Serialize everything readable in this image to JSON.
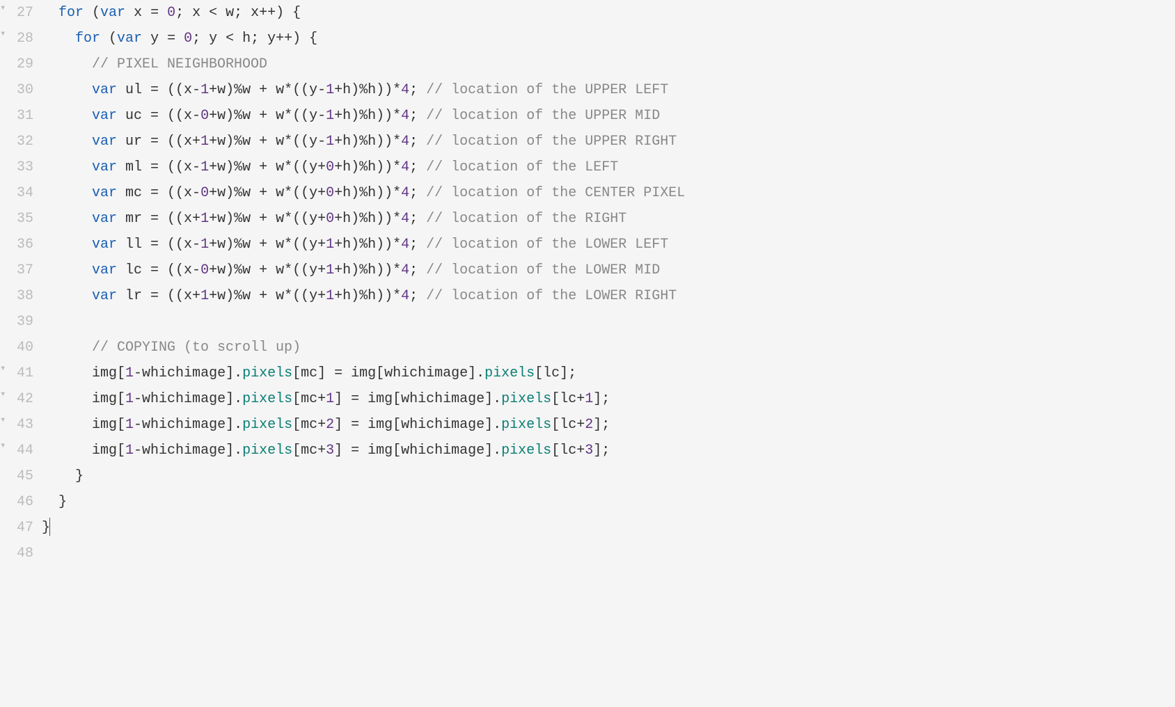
{
  "editor": {
    "startLine": 27,
    "cursorLine": 47,
    "lines": [
      {
        "num": 27,
        "foldable": true,
        "indent": "  ",
        "tokens": [
          {
            "t": "keyword",
            "v": "for"
          },
          {
            "t": "punct",
            "v": " ("
          },
          {
            "t": "keyword",
            "v": "var"
          },
          {
            "t": "ident",
            "v": " x "
          },
          {
            "t": "punct",
            "v": "= "
          },
          {
            "t": "number",
            "v": "0"
          },
          {
            "t": "punct",
            "v": "; x < w; x++) {"
          }
        ]
      },
      {
        "num": 28,
        "foldable": true,
        "indent": "    ",
        "tokens": [
          {
            "t": "keyword",
            "v": "for"
          },
          {
            "t": "punct",
            "v": " ("
          },
          {
            "t": "keyword",
            "v": "var"
          },
          {
            "t": "ident",
            "v": " y "
          },
          {
            "t": "punct",
            "v": "= "
          },
          {
            "t": "number",
            "v": "0"
          },
          {
            "t": "punct",
            "v": "; y < h; y++) {"
          }
        ]
      },
      {
        "num": 29,
        "foldable": false,
        "indent": "      ",
        "tokens": [
          {
            "t": "comment",
            "v": "// PIXEL NEIGHBORHOOD"
          }
        ]
      },
      {
        "num": 30,
        "foldable": false,
        "indent": "      ",
        "tokens": [
          {
            "t": "keyword",
            "v": "var"
          },
          {
            "t": "ident",
            "v": " ul = ((x-"
          },
          {
            "t": "number",
            "v": "1"
          },
          {
            "t": "ident",
            "v": "+w)%w + w*((y-"
          },
          {
            "t": "number",
            "v": "1"
          },
          {
            "t": "ident",
            "v": "+h)%h))*"
          },
          {
            "t": "number",
            "v": "4"
          },
          {
            "t": "punct",
            "v": "; "
          },
          {
            "t": "comment",
            "v": "// location of the UPPER LEFT"
          }
        ]
      },
      {
        "num": 31,
        "foldable": false,
        "indent": "      ",
        "tokens": [
          {
            "t": "keyword",
            "v": "var"
          },
          {
            "t": "ident",
            "v": " uc = ((x-"
          },
          {
            "t": "number",
            "v": "0"
          },
          {
            "t": "ident",
            "v": "+w)%w + w*((y-"
          },
          {
            "t": "number",
            "v": "1"
          },
          {
            "t": "ident",
            "v": "+h)%h))*"
          },
          {
            "t": "number",
            "v": "4"
          },
          {
            "t": "punct",
            "v": "; "
          },
          {
            "t": "comment",
            "v": "// location of the UPPER MID"
          }
        ]
      },
      {
        "num": 32,
        "foldable": false,
        "indent": "      ",
        "tokens": [
          {
            "t": "keyword",
            "v": "var"
          },
          {
            "t": "ident",
            "v": " ur = ((x+"
          },
          {
            "t": "number",
            "v": "1"
          },
          {
            "t": "ident",
            "v": "+w)%w + w*((y-"
          },
          {
            "t": "number",
            "v": "1"
          },
          {
            "t": "ident",
            "v": "+h)%h))*"
          },
          {
            "t": "number",
            "v": "4"
          },
          {
            "t": "punct",
            "v": "; "
          },
          {
            "t": "comment",
            "v": "// location of the UPPER RIGHT"
          }
        ]
      },
      {
        "num": 33,
        "foldable": false,
        "indent": "      ",
        "tokens": [
          {
            "t": "keyword",
            "v": "var"
          },
          {
            "t": "ident",
            "v": " ml = ((x-"
          },
          {
            "t": "number",
            "v": "1"
          },
          {
            "t": "ident",
            "v": "+w)%w + w*((y+"
          },
          {
            "t": "number",
            "v": "0"
          },
          {
            "t": "ident",
            "v": "+h)%h))*"
          },
          {
            "t": "number",
            "v": "4"
          },
          {
            "t": "punct",
            "v": "; "
          },
          {
            "t": "comment",
            "v": "// location of the LEFT"
          }
        ]
      },
      {
        "num": 34,
        "foldable": false,
        "indent": "      ",
        "tokens": [
          {
            "t": "keyword",
            "v": "var"
          },
          {
            "t": "ident",
            "v": " mc = ((x-"
          },
          {
            "t": "number",
            "v": "0"
          },
          {
            "t": "ident",
            "v": "+w)%w + w*((y+"
          },
          {
            "t": "number",
            "v": "0"
          },
          {
            "t": "ident",
            "v": "+h)%h))*"
          },
          {
            "t": "number",
            "v": "4"
          },
          {
            "t": "punct",
            "v": "; "
          },
          {
            "t": "comment",
            "v": "// location of the CENTER PIXEL"
          }
        ]
      },
      {
        "num": 35,
        "foldable": false,
        "indent": "      ",
        "tokens": [
          {
            "t": "keyword",
            "v": "var"
          },
          {
            "t": "ident",
            "v": " mr = ((x+"
          },
          {
            "t": "number",
            "v": "1"
          },
          {
            "t": "ident",
            "v": "+w)%w + w*((y+"
          },
          {
            "t": "number",
            "v": "0"
          },
          {
            "t": "ident",
            "v": "+h)%h))*"
          },
          {
            "t": "number",
            "v": "4"
          },
          {
            "t": "punct",
            "v": "; "
          },
          {
            "t": "comment",
            "v": "// location of the RIGHT"
          }
        ]
      },
      {
        "num": 36,
        "foldable": false,
        "indent": "      ",
        "tokens": [
          {
            "t": "keyword",
            "v": "var"
          },
          {
            "t": "ident",
            "v": " ll = ((x-"
          },
          {
            "t": "number",
            "v": "1"
          },
          {
            "t": "ident",
            "v": "+w)%w + w*((y+"
          },
          {
            "t": "number",
            "v": "1"
          },
          {
            "t": "ident",
            "v": "+h)%h))*"
          },
          {
            "t": "number",
            "v": "4"
          },
          {
            "t": "punct",
            "v": "; "
          },
          {
            "t": "comment",
            "v": "// location of the LOWER LEFT"
          }
        ]
      },
      {
        "num": 37,
        "foldable": false,
        "indent": "      ",
        "tokens": [
          {
            "t": "keyword",
            "v": "var"
          },
          {
            "t": "ident",
            "v": " lc = ((x-"
          },
          {
            "t": "number",
            "v": "0"
          },
          {
            "t": "ident",
            "v": "+w)%w + w*((y+"
          },
          {
            "t": "number",
            "v": "1"
          },
          {
            "t": "ident",
            "v": "+h)%h))*"
          },
          {
            "t": "number",
            "v": "4"
          },
          {
            "t": "punct",
            "v": "; "
          },
          {
            "t": "comment",
            "v": "// location of the LOWER MID"
          }
        ]
      },
      {
        "num": 38,
        "foldable": false,
        "indent": "      ",
        "tokens": [
          {
            "t": "keyword",
            "v": "var"
          },
          {
            "t": "ident",
            "v": " lr = ((x+"
          },
          {
            "t": "number",
            "v": "1"
          },
          {
            "t": "ident",
            "v": "+w)%w + w*((y+"
          },
          {
            "t": "number",
            "v": "1"
          },
          {
            "t": "ident",
            "v": "+h)%h))*"
          },
          {
            "t": "number",
            "v": "4"
          },
          {
            "t": "punct",
            "v": "; "
          },
          {
            "t": "comment",
            "v": "// location of the LOWER RIGHT"
          }
        ]
      },
      {
        "num": 39,
        "foldable": false,
        "indent": "",
        "tokens": []
      },
      {
        "num": 40,
        "foldable": false,
        "indent": "      ",
        "tokens": [
          {
            "t": "comment",
            "v": "// COPYING (to scroll up)"
          }
        ]
      },
      {
        "num": 41,
        "foldable": true,
        "indent": "      ",
        "tokens": [
          {
            "t": "ident",
            "v": "img["
          },
          {
            "t": "number",
            "v": "1"
          },
          {
            "t": "ident",
            "v": "-whichimage]."
          },
          {
            "t": "prop",
            "v": "pixels"
          },
          {
            "t": "ident",
            "v": "[mc] = img[whichimage]."
          },
          {
            "t": "prop",
            "v": "pixels"
          },
          {
            "t": "ident",
            "v": "[lc];"
          }
        ]
      },
      {
        "num": 42,
        "foldable": true,
        "indent": "      ",
        "tokens": [
          {
            "t": "ident",
            "v": "img["
          },
          {
            "t": "number",
            "v": "1"
          },
          {
            "t": "ident",
            "v": "-whichimage]."
          },
          {
            "t": "prop",
            "v": "pixels"
          },
          {
            "t": "ident",
            "v": "[mc+"
          },
          {
            "t": "number",
            "v": "1"
          },
          {
            "t": "ident",
            "v": "] = img[whichimage]."
          },
          {
            "t": "prop",
            "v": "pixels"
          },
          {
            "t": "ident",
            "v": "[lc+"
          },
          {
            "t": "number",
            "v": "1"
          },
          {
            "t": "ident",
            "v": "];"
          }
        ]
      },
      {
        "num": 43,
        "foldable": true,
        "indent": "      ",
        "tokens": [
          {
            "t": "ident",
            "v": "img["
          },
          {
            "t": "number",
            "v": "1"
          },
          {
            "t": "ident",
            "v": "-whichimage]."
          },
          {
            "t": "prop",
            "v": "pixels"
          },
          {
            "t": "ident",
            "v": "[mc+"
          },
          {
            "t": "number",
            "v": "2"
          },
          {
            "t": "ident",
            "v": "] = img[whichimage]."
          },
          {
            "t": "prop",
            "v": "pixels"
          },
          {
            "t": "ident",
            "v": "[lc+"
          },
          {
            "t": "number",
            "v": "2"
          },
          {
            "t": "ident",
            "v": "];"
          }
        ]
      },
      {
        "num": 44,
        "foldable": true,
        "indent": "      ",
        "tokens": [
          {
            "t": "ident",
            "v": "img["
          },
          {
            "t": "number",
            "v": "1"
          },
          {
            "t": "ident",
            "v": "-whichimage]."
          },
          {
            "t": "prop",
            "v": "pixels"
          },
          {
            "t": "ident",
            "v": "[mc+"
          },
          {
            "t": "number",
            "v": "3"
          },
          {
            "t": "ident",
            "v": "] = img[whichimage]."
          },
          {
            "t": "prop",
            "v": "pixels"
          },
          {
            "t": "ident",
            "v": "[lc+"
          },
          {
            "t": "number",
            "v": "3"
          },
          {
            "t": "ident",
            "v": "];"
          }
        ]
      },
      {
        "num": 45,
        "foldable": false,
        "indent": "    ",
        "tokens": [
          {
            "t": "punct",
            "v": "}"
          }
        ]
      },
      {
        "num": 46,
        "foldable": false,
        "indent": "  ",
        "tokens": [
          {
            "t": "punct",
            "v": "}"
          }
        ]
      },
      {
        "num": 47,
        "foldable": false,
        "indent": "",
        "tokens": [
          {
            "t": "punct",
            "v": "}"
          }
        ],
        "cursor": true
      },
      {
        "num": 48,
        "foldable": false,
        "indent": "",
        "tokens": []
      }
    ]
  }
}
